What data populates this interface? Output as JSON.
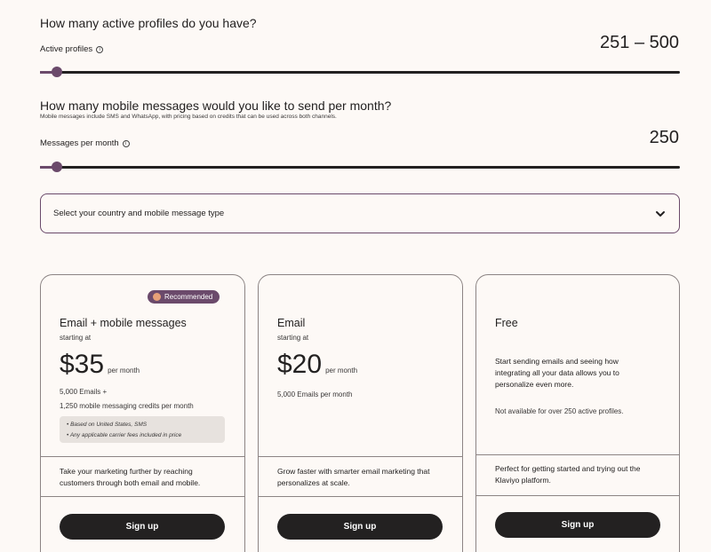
{
  "profiles": {
    "question": "How many active profiles do you have?",
    "label": "Active profiles",
    "info_icon": "i",
    "value": "251 – 500",
    "slider_fraction": 0.03
  },
  "messages": {
    "question": "How many mobile messages would you like to send per month?",
    "subtext": "Mobile messages include SMS and WhatsApp, with pricing based on credits that can be used across both channels.",
    "label": "Messages per month",
    "info_icon": "i",
    "value": "250",
    "slider_fraction": 0.03
  },
  "country_select": {
    "placeholder": "Select your country and mobile message type"
  },
  "plans": [
    {
      "badge": "Recommended",
      "title": "Email + mobile messages",
      "starting": "starting at",
      "price": "$35",
      "per": "per month",
      "detail1": "5,000 Emails +",
      "detail2": "1,250 mobile messaging credits per month",
      "note1": "• Based on United States, SMS",
      "note2": "• Any applicable carrier fees included in price",
      "desc": "Take your marketing further by reaching customers through both email and mobile.",
      "cta": "Sign up"
    },
    {
      "title": "Email",
      "starting": "starting at",
      "price": "$20",
      "per": "per month",
      "detail1": "5,000 Emails per month",
      "desc": "Grow faster with smarter email marketing that personalizes at scale.",
      "cta": "Sign up"
    },
    {
      "title": "Free",
      "body": "Start sending emails and seeing how integrating all your data allows you to personalize even more.",
      "note": "Not available for over 250 active profiles.",
      "desc": "Perfect for getting started and trying out the Klaviyo platform.",
      "cta": "Sign up"
    }
  ],
  "colors": {
    "accent": "#6b4a6b",
    "dark": "#232121",
    "background": "#fdf9f6"
  }
}
